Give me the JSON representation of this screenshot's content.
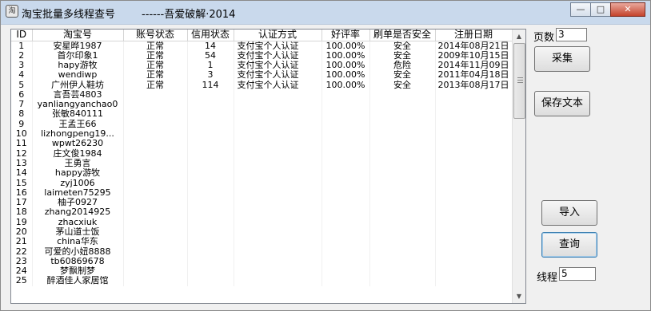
{
  "window": {
    "icon_text": "淘",
    "title": "淘宝批量多线程查号        ------吾爱破解·2014",
    "controls": {
      "minimize": "—",
      "maximize": "□",
      "close": "✕"
    }
  },
  "table": {
    "columns": [
      "ID",
      "淘宝号",
      "账号状态",
      "信用状态",
      "认证方式",
      "好评率",
      "刷单是否安全",
      "注册日期"
    ],
    "rows": [
      [
        "1",
        "安星晔1987",
        "正常",
        "14",
        "支付宝个人认证",
        "100.00%",
        "安全",
        "2014年08月21日"
      ],
      [
        "2",
        "首尔印象1",
        "正常",
        "54",
        "支付宝个人认证",
        "100.00%",
        "安全",
        "2009年10月15日"
      ],
      [
        "3",
        "hapy游牧",
        "正常",
        "1",
        "支付宝个人认证",
        "100.00%",
        "危险",
        "2014年11月09日"
      ],
      [
        "4",
        "wendiwp",
        "正常",
        "3",
        "支付宝个人认证",
        "100.00%",
        "安全",
        "2011年04月18日"
      ],
      [
        "5",
        "广州伊人鞋坊",
        "正常",
        "114",
        "支付宝个人认证",
        "100.00%",
        "安全",
        "2013年08月17日"
      ],
      [
        "6",
        "言吾芸4803",
        "",
        "",
        "",
        "",
        "",
        ""
      ],
      [
        "7",
        "yanliangyanchao0",
        "",
        "",
        "",
        "",
        "",
        ""
      ],
      [
        "8",
        "张敏840111",
        "",
        "",
        "",
        "",
        "",
        ""
      ],
      [
        "9",
        "王孟王66",
        "",
        "",
        "",
        "",
        "",
        ""
      ],
      [
        "10",
        "lizhongpeng19...",
        "",
        "",
        "",
        "",
        "",
        ""
      ],
      [
        "11",
        "wpwt26230",
        "",
        "",
        "",
        "",
        "",
        ""
      ],
      [
        "12",
        "庄文俊1984",
        "",
        "",
        "",
        "",
        "",
        ""
      ],
      [
        "13",
        "王勇言",
        "",
        "",
        "",
        "",
        "",
        ""
      ],
      [
        "14",
        "happy游牧",
        "",
        "",
        "",
        "",
        "",
        ""
      ],
      [
        "15",
        "zyj1006",
        "",
        "",
        "",
        "",
        "",
        ""
      ],
      [
        "16",
        "laimeten75295",
        "",
        "",
        "",
        "",
        "",
        ""
      ],
      [
        "17",
        "柚子0927",
        "",
        "",
        "",
        "",
        "",
        ""
      ],
      [
        "18",
        "zhang2014925",
        "",
        "",
        "",
        "",
        "",
        ""
      ],
      [
        "19",
        "zhacxiuk",
        "",
        "",
        "",
        "",
        "",
        ""
      ],
      [
        "20",
        "茅山道士饭",
        "",
        "",
        "",
        "",
        "",
        ""
      ],
      [
        "21",
        "china华东",
        "",
        "",
        "",
        "",
        "",
        ""
      ],
      [
        "22",
        "可爱的小妞8888",
        "",
        "",
        "",
        "",
        "",
        ""
      ],
      [
        "23",
        "tb60869678",
        "",
        "",
        "",
        "",
        "",
        ""
      ],
      [
        "24",
        "梦飘制梦",
        "",
        "",
        "",
        "",
        "",
        ""
      ],
      [
        "25",
        "醉酒佳人家居馆",
        "",
        "",
        "",
        "",
        "",
        ""
      ]
    ]
  },
  "controls": {
    "pages_label": "页数",
    "pages_value": "3",
    "collect_button": "采集",
    "save_text_button": "保存文本",
    "import_button": "导入",
    "query_button": "查询",
    "threads_label": "线程",
    "threads_value": "5"
  },
  "icons": {
    "scroll_up": "▲",
    "scroll_down": "▼"
  }
}
